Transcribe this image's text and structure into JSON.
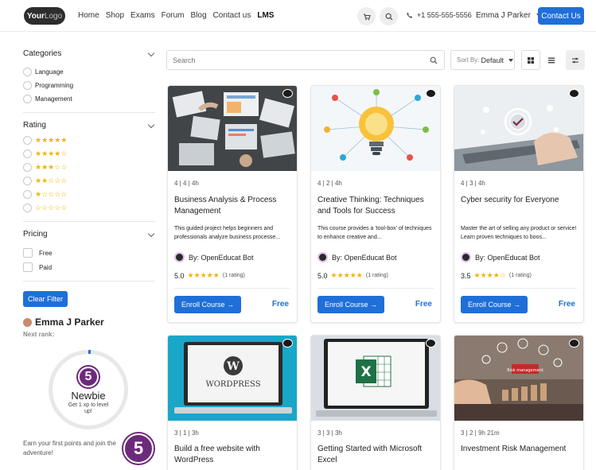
{
  "header": {
    "logo_your": "Your",
    "logo_logo": "Logo",
    "nav": [
      "Home",
      "Shop",
      "Exams",
      "Forum",
      "Blog",
      "Contact us",
      "LMS"
    ],
    "active_nav": "LMS",
    "phone": "+1 555-555-5556",
    "user": "Emma J Parker",
    "contact_label": "Contact Us"
  },
  "toolbar": {
    "search_placeholder": "Search",
    "sort_label": "Sort By:",
    "sort_value": "Default"
  },
  "sidebar": {
    "categories_title": "Categories",
    "categories": [
      "Language",
      "Programming",
      "Management"
    ],
    "rating_title": "Rating",
    "ratings": [
      "★★★★★",
      "★★★★☆",
      "★★★☆☆",
      "★★☆☆☆",
      "★☆☆☆☆",
      "☆☆☆☆☆"
    ],
    "pricing_title": "Pricing",
    "pricing": [
      "Free",
      "Paid"
    ],
    "clear_label": "Clear Filter",
    "rank": {
      "user": "Emma J Parker",
      "next_rank_label": "Next rank:",
      "level": "5",
      "rank_name": "Newbie",
      "hint": "Get 1 xp to level up!",
      "earn_text": "Earn your first points and join the adventure!",
      "progress": 0.01
    }
  },
  "courses": [
    {
      "meta": "4 | 4 | 4h",
      "title": "Business Analysis & Process Management",
      "desc": "This guided project helps beginners and professionals analyze business processe...",
      "author": "By: OpenEducat Bot",
      "rating": "5.0",
      "stars": "★★★★★",
      "rating_count": "(1 rating)",
      "enroll": "Enroll Course →",
      "price": "Free"
    },
    {
      "meta": "4 | 2 | 4h",
      "title": "Creative Thinking: Techniques and Tools for Success",
      "desc": "This course provides a 'tool-box' of techniques to enhance creative and...",
      "author": "By: OpenEducat Bot",
      "rating": "5.0",
      "stars": "★★★★★",
      "rating_count": "(1 rating)",
      "enroll": "Enroll Course →",
      "price": "Free"
    },
    {
      "meta": "4 | 3 | 4h",
      "title": "Cyber security for Everyone",
      "desc": "Master the art of selling any product or service! Learn proven techniques to boos...",
      "author": "By: OpenEducat Bot",
      "rating": "3.5",
      "stars": "★★★★☆",
      "rating_count": "(1 rating)",
      "enroll": "Enroll Course →",
      "price": "Free"
    },
    {
      "meta": "3 | 1 | 3h",
      "title": "Build a free website with WordPress"
    },
    {
      "meta": "3 | 3 | 3h",
      "title": "Getting Started with Microsoft Excel"
    },
    {
      "meta": "3 | 2 | 9h 21m",
      "title": "Investment Risk Management"
    }
  ],
  "image_text": {
    "wordpress": "WORDPRESS",
    "excel": "X",
    "risk": "Risk management"
  },
  "colors": {
    "accent": "#1f6fd8",
    "badge": "#6d2a7c",
    "star": "#f0b400"
  }
}
